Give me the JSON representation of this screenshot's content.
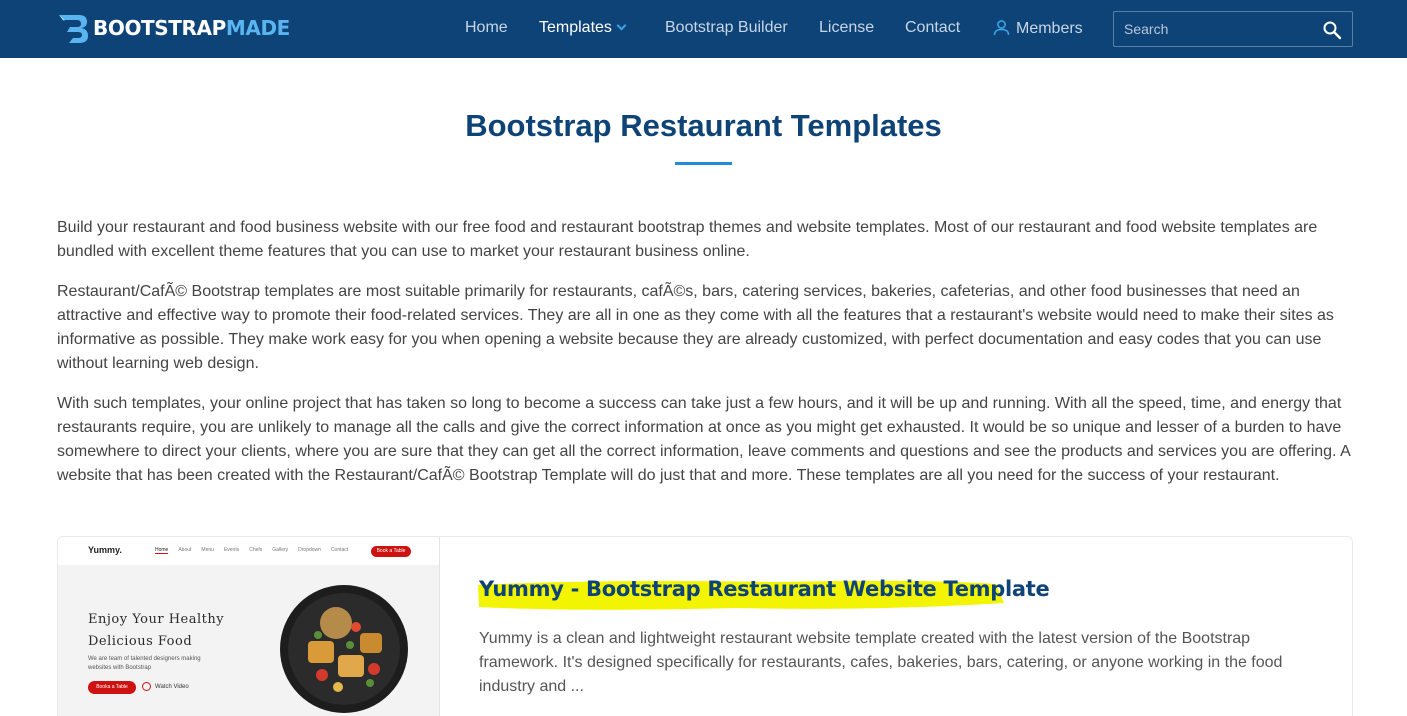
{
  "header": {
    "logo": {
      "part1": "BOOTSTRAP",
      "part2": "MADE"
    },
    "nav": [
      {
        "label": "Home"
      },
      {
        "label": "Templates"
      },
      {
        "label": "Bootstrap Builder"
      },
      {
        "label": "License"
      },
      {
        "label": "Contact"
      },
      {
        "label": "Members"
      }
    ],
    "search": {
      "placeholder": "Search"
    },
    "colors": {
      "background": "#0e4377",
      "accent": "#5ab4f0"
    }
  },
  "page": {
    "title": "Bootstrap Restaurant Templates",
    "paragraphs": [
      "Build your restaurant and food business website with our free food and restaurant bootstrap themes and website templates. Most of our restaurant and food website templates are bundled with excellent theme features that you can use to market your restaurant business online.",
      "Restaurant/CafÃ© Bootstrap templates are most suitable primarily for restaurants, cafÃ©s, bars, catering services, bakeries, cafeterias, and other food businesses that need an attractive and effective way to promote their food-related services. They are all in one as they come with all the features that a restaurant's website would need to make their sites as informative as possible. They make work easy for you when opening a website because they are already customized, with perfect documentation and easy codes that you can use without learning web design.",
      "With such templates, your online project that has taken so long to become a success can take just a few hours, and it will be up and running. With all the speed, time, and energy that restaurants require, you are unlikely to manage all the calls and give the correct information at once as you might get exhausted. It would be so unique and lesser of a burden to have somewhere to direct your clients, where you are sure that they can get all the correct information, leave comments and questions and see the products and services you are offering. A website that has been created with the Restaurant/CafÃ© Bootstrap Template will do just that and more. These templates are all you need for the success of your restaurant."
    ]
  },
  "template_card": {
    "title": "Yummy - Bootstrap Restaurant Website Template",
    "description": "Yummy is a clean and lightweight restaurant website template created with the latest version of the Bootstrap framework. It's designed specifically for restaurants, cafes, bakeries, bars, catering, or anyone working in the food industry and ...",
    "highlight_color": "#f3f500",
    "thumbnail": {
      "brand": "Yummy.",
      "nav": [
        "Home",
        "About",
        "Menu",
        "Events",
        "Chefs",
        "Gallery",
        "Dropdown",
        "Contact"
      ],
      "book_button": "Book a Table",
      "headline_line1": "Enjoy Your Healthy",
      "headline_line2": "Delicious Food",
      "subtext": "We are team of talented designers making websites with Bootstrap",
      "cta": "Booka a Table",
      "watch": "Watch Video"
    }
  }
}
